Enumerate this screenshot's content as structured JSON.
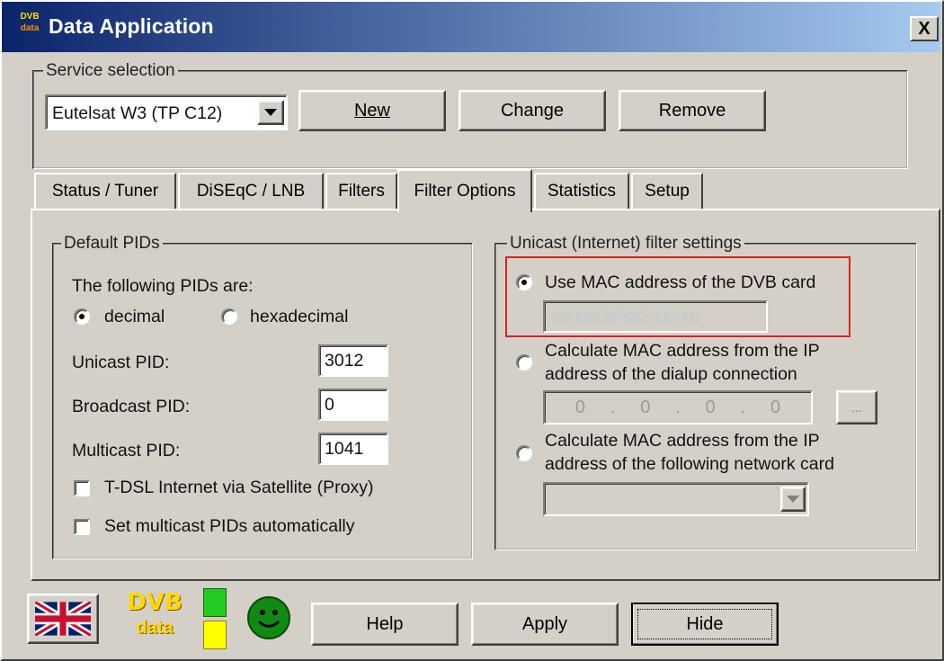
{
  "window": {
    "title": "Data Application",
    "icon_name": "dvb-app-icon",
    "icon_text_top": "DVB",
    "icon_text_bottom": "data",
    "close_label": "X"
  },
  "service_selection": {
    "legend": "Service selection",
    "selected": "Eutelsat W3 (TP C12)",
    "new_label": "New",
    "change_label": "Change",
    "remove_label": "Remove"
  },
  "tabs": [
    {
      "label": "Status / Tuner",
      "active": false
    },
    {
      "label": "DiSEqC / LNB",
      "active": false
    },
    {
      "label": "Filters",
      "active": false
    },
    {
      "label": "Filter Options",
      "active": true
    },
    {
      "label": "Statistics",
      "active": false
    },
    {
      "label": "Setup",
      "active": false
    }
  ],
  "default_pids": {
    "legend": "Default PIDs",
    "intro": "The following PIDs are:",
    "decimal_label": "decimal",
    "hexadecimal_label": "hexadecimal",
    "selected_format": "decimal",
    "unicast_label": "Unicast PID:",
    "unicast_value": "3012",
    "broadcast_label": "Broadcast PID:",
    "broadcast_value": "0",
    "multicast_label": "Multicast PID:",
    "multicast_value": "1041",
    "tdsl_label": "T-DSL Internet via Satellite (Proxy)",
    "tdsl_checked": false,
    "auto_multicast_label": "Set multicast PIDs automatically",
    "auto_multicast_checked": false
  },
  "unicast_filter": {
    "legend": "Unicast (Internet) filter settings",
    "option1_label": "Use MAC address of the DVB card",
    "mac_value_obscured": "00:D0:5F:0D:1C:4E",
    "option2_line1": "Calculate MAC address from the IP",
    "option2_line2": "address of the dialup connection",
    "ip_octets": [
      "0",
      "0",
      "0",
      "0"
    ],
    "browse_label": "...",
    "option3_line1": "Calculate MAC address from the IP",
    "option3_line2": "address of the following network card",
    "network_card_selected": "",
    "selected_option": 1,
    "highlight_color": "#e02020"
  },
  "footer": {
    "flag_icon": "uk-flag-icon",
    "logo_top": "DVB",
    "logo_bottom": "data",
    "status_colors": [
      "#22cc22",
      "#ffff00"
    ],
    "smiley_icon": "smiley-icon",
    "help_label": "Help",
    "apply_label": "Apply",
    "hide_label": "Hide"
  }
}
